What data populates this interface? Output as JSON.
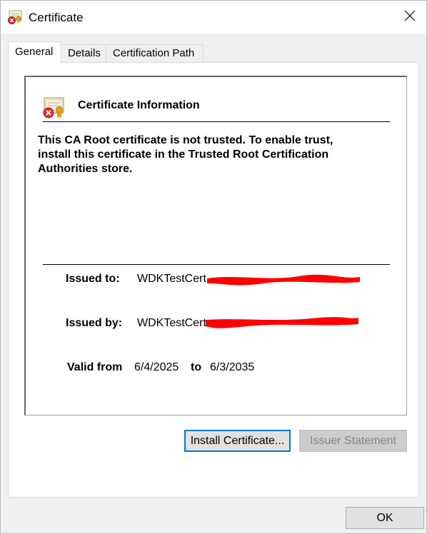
{
  "window": {
    "title": "Certificate"
  },
  "tabs": [
    {
      "label": "General"
    },
    {
      "label": "Details"
    },
    {
      "label": "Certification Path"
    }
  ],
  "general": {
    "heading": "Certificate Information",
    "warning_lines": [
      "This CA Root certificate is not trusted. To enable trust,",
      "install this certificate in the Trusted Root Certification",
      "Authorities store."
    ],
    "issued_to_label": "Issued to:",
    "issued_to_value": "WDKTestCert",
    "issued_by_label": "Issued by:",
    "issued_by_value": "WDKTestCert",
    "valid_from_label": "Valid from",
    "valid_from": "6/4/2025",
    "to_label": "to",
    "valid_to": "6/3/2035"
  },
  "buttons": {
    "install": "Install Certificate...",
    "issuer_statement": "Issuer Statement",
    "ok": "OK"
  },
  "colors": {
    "redaction": "#ff0000",
    "focus_border": "#0078d7"
  },
  "icons": {
    "title": "certificate-untrusted-icon",
    "info": "certificate-untrusted-icon",
    "close": "close-icon"
  }
}
